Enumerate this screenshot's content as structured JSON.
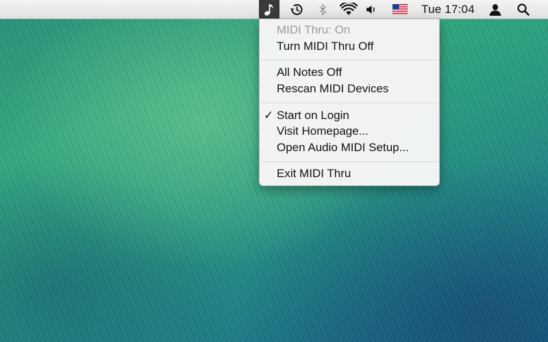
{
  "menubar": {
    "icons": {
      "app": "music-note-icon",
      "time_machine": "time-machine-icon",
      "bluetooth": "bluetooth-icon",
      "wifi": "wifi-icon",
      "volume": "volume-icon",
      "input_source": "us-flag-icon",
      "user": "user-icon",
      "spotlight": "spotlight-search-icon"
    },
    "clock": "Tue 17:04"
  },
  "menu": {
    "status": "MIDI Thru: On",
    "toggle": "Turn MIDI Thru Off",
    "all_notes_off": "All Notes Off",
    "rescan": "Rescan MIDI Devices",
    "checkmark": "✓",
    "start_on_login": "Start on Login",
    "visit_homepage": "Visit Homepage...",
    "open_audio_midi_setup": "Open Audio MIDI Setup...",
    "exit": "Exit MIDI Thru"
  },
  "colors": {
    "menubar_bg": "#e6e6e6",
    "highlighted_menubar_item": "#3a3a3a",
    "menu_bg": "#f5f5f5",
    "disabled_text": "#9a9a9a",
    "wallpaper_green": "#2f9d7e",
    "wallpaper_blue": "#1a5f86"
  }
}
